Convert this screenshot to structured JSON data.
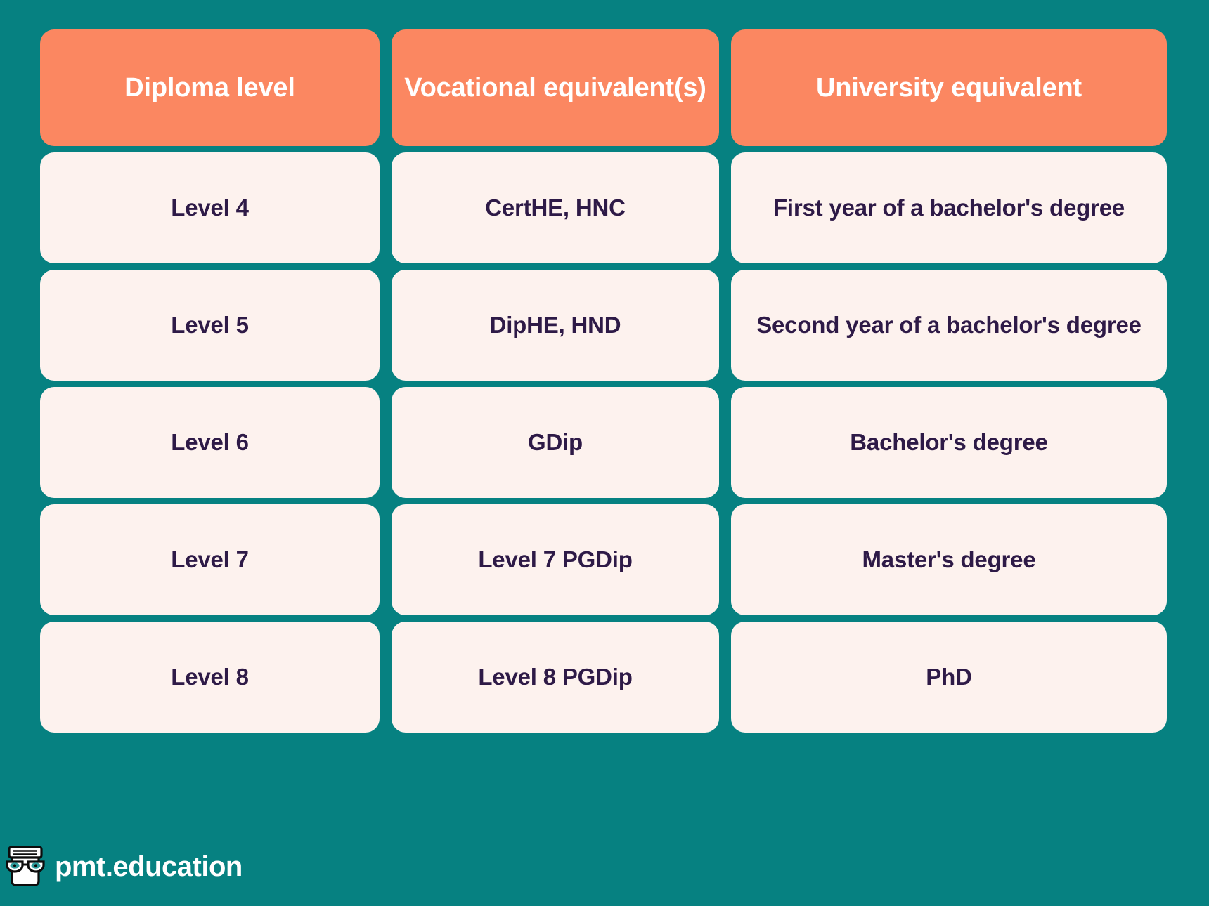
{
  "theme": {
    "background_color": "#068181",
    "header_card_color": "#FB8761",
    "body_card_color": "#FDF2EE",
    "header_text_color": "#FFFFFF",
    "body_text_color": "#2E1A47",
    "logo_eye_color": "#2E9C9C"
  },
  "table": {
    "headers": [
      "Diploma level",
      "Vocational equivalent(s)",
      "University equivalent"
    ],
    "rows": [
      {
        "diploma_level": "Level 4",
        "vocational_equivalent": "CertHE, HNC",
        "university_equivalent": "First year of a bachelor's degree"
      },
      {
        "diploma_level": "Level 5",
        "vocational_equivalent": "DipHE, HND",
        "university_equivalent": "Second year of a bachelor's degree"
      },
      {
        "diploma_level": "Level 6",
        "vocational_equivalent": "GDip",
        "university_equivalent": "Bachelor's degree"
      },
      {
        "diploma_level": "Level 7",
        "vocational_equivalent": "Level 7 PGDip",
        "university_equivalent": "Master's degree"
      },
      {
        "diploma_level": "Level 8",
        "vocational_equivalent": "Level 8 PGDip",
        "university_equivalent": "PhD"
      }
    ]
  },
  "footer": {
    "logo_icon": "pmt-mascot-icon",
    "wordmark": "pmt.education"
  }
}
